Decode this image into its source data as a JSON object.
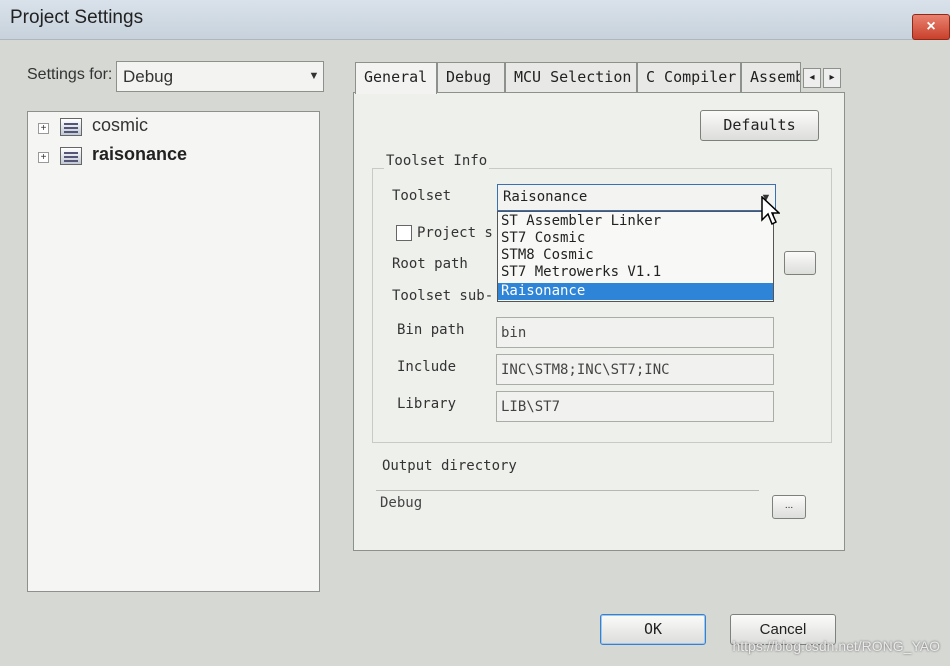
{
  "window": {
    "title": "Project Settings",
    "close": "×"
  },
  "settings_for": {
    "label": "Settings for:",
    "value": "Debug"
  },
  "tree": {
    "items": [
      {
        "label": "cosmic"
      },
      {
        "label": "raisonance"
      }
    ]
  },
  "tabs": [
    {
      "label": "General"
    },
    {
      "label": "Debug"
    },
    {
      "label": "MCU Selection"
    },
    {
      "label": "C Compiler"
    },
    {
      "label": "Assembl"
    }
  ],
  "tab_scroll": {
    "left": "◂",
    "right": "▸"
  },
  "general": {
    "defaults_button": "Defaults",
    "toolset_info_label": "Toolset Info",
    "toolset_label": "Toolset",
    "toolset_value": "Raisonance",
    "project_specific_label": "Project s",
    "root_path_label": "Root path",
    "toolset_sub_label": "Toolset sub-",
    "bin_path_label": "Bin path",
    "bin_path_value": "bin",
    "include_label": "Include",
    "include_value": "INC\\STM8;INC\\ST7;INC",
    "library_label": "Library",
    "library_value": "LIB\\ST7",
    "output_directory_label": "Output directory",
    "output_directory_value": "Debug",
    "browse_label": "..."
  },
  "toolset_options": [
    {
      "label": "ST Assembler Linker",
      "selected": false
    },
    {
      "label": "ST7 Cosmic",
      "selected": false
    },
    {
      "label": "STM8 Cosmic",
      "selected": false
    },
    {
      "label": "ST7 Metrowerks V1.1",
      "selected": false
    },
    {
      "label": "Raisonance",
      "selected": true
    }
  ],
  "footer": {
    "ok": "OK",
    "cancel": "Cancel",
    "watermark": "https://blog.csdn.net/RONG_YAO"
  }
}
